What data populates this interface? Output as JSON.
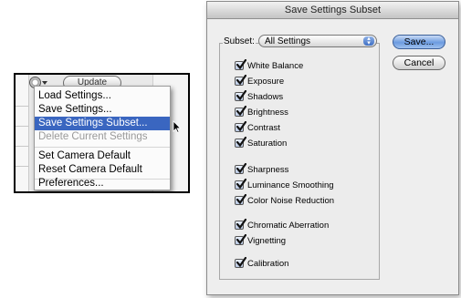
{
  "menu_panel": {
    "update_button": "Update",
    "items": [
      {
        "label": "Load Settings...",
        "state": "normal"
      },
      {
        "label": "Save Settings...",
        "state": "normal"
      },
      {
        "label": "Save Settings Subset...",
        "state": "highlighted"
      },
      {
        "label": "Delete Current Settings",
        "state": "disabled"
      },
      {
        "label": "Set Camera Default",
        "state": "normal"
      },
      {
        "label": "Reset Camera Default",
        "state": "normal"
      },
      {
        "label": "Preferences...",
        "state": "normal"
      }
    ],
    "highlight_color": "#3a66c0"
  },
  "dialog": {
    "title": "Save Settings Subset",
    "subset_label": "Subset:",
    "subset_value": "All Settings",
    "save_label": "Save...",
    "cancel_label": "Cancel",
    "checkboxes": [
      {
        "label": "White Balance",
        "checked": true
      },
      {
        "label": "Exposure",
        "checked": true
      },
      {
        "label": "Shadows",
        "checked": true
      },
      {
        "label": "Brightness",
        "checked": true
      },
      {
        "label": "Contrast",
        "checked": true
      },
      {
        "label": "Saturation",
        "checked": true
      },
      {
        "label": "Sharpness",
        "checked": true
      },
      {
        "label": "Luminance Smoothing",
        "checked": true
      },
      {
        "label": "Color Noise Reduction",
        "checked": true
      },
      {
        "label": "Chromatic Aberration",
        "checked": true
      },
      {
        "label": "Vignetting",
        "checked": true
      },
      {
        "label": "Calibration",
        "checked": true
      }
    ]
  }
}
